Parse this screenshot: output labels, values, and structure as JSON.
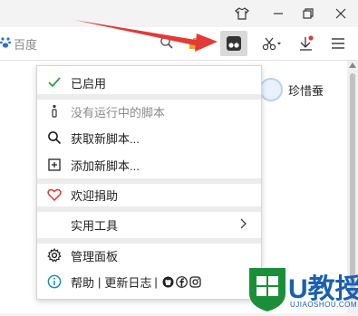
{
  "browser": {
    "search_engine": "百度"
  },
  "profile": {
    "user_name": "珍惜蚕"
  },
  "menu": {
    "enabled_label": "已启用",
    "no_scripts_label": "没有运行中的脚本",
    "get_scripts_label": "获取新脚本...",
    "add_script_label": "添加新脚本...",
    "donate_label": "欢迎捐助",
    "utilities_label": "实用工具",
    "dashboard_label": "管理面板",
    "help_label": "帮助",
    "changelog_label": "更新日志",
    "divider": "|"
  },
  "watermark": {
    "brand": "U教授",
    "url": "UJIAOSHOU.COM"
  },
  "colors": {
    "check_green": "#2e9e3e",
    "heart_red": "#e03a3a",
    "info_teal": "#1e8fb0",
    "arrow_red": "#e53935",
    "watermark_green": "#1a8f3a",
    "watermark_blue": "#1a5fb4"
  }
}
